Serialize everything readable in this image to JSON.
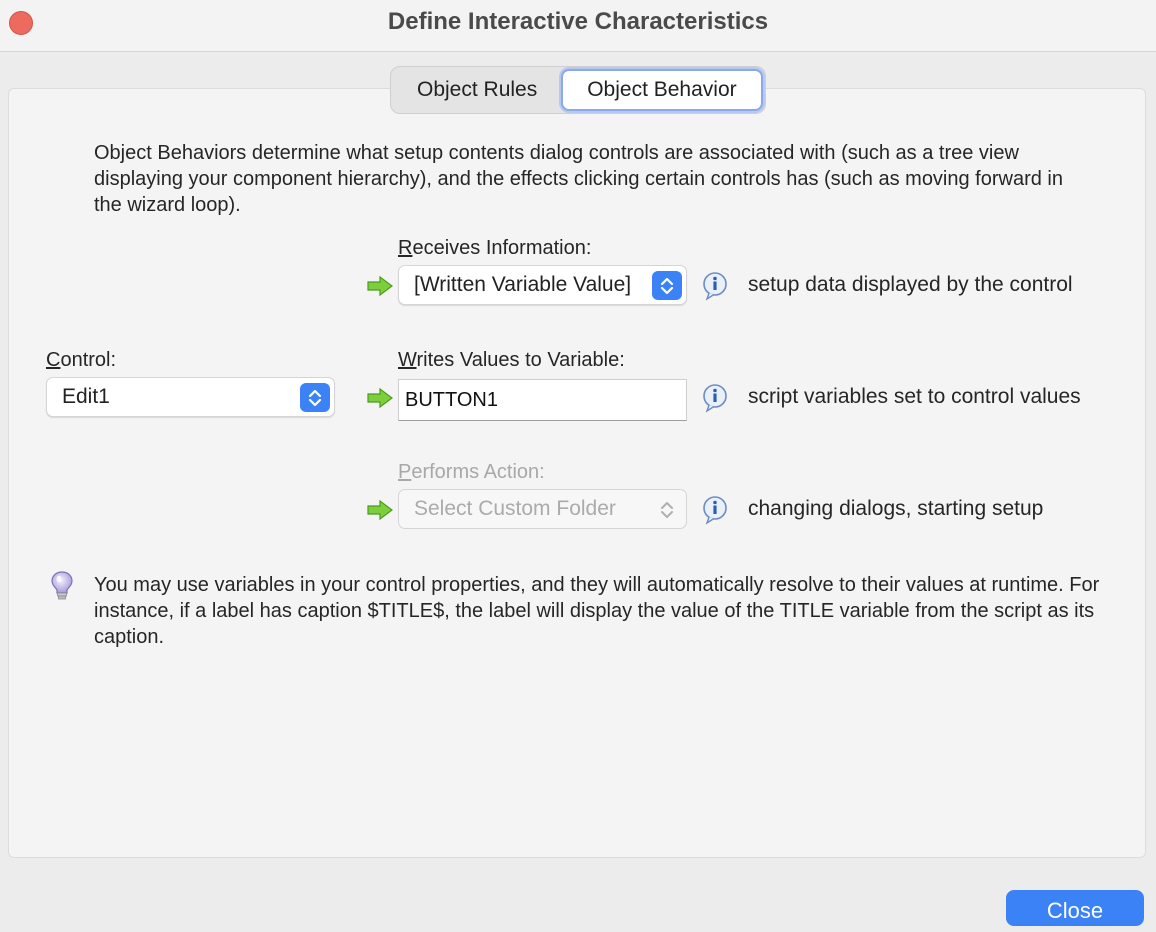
{
  "window": {
    "title": "Define Interactive Characteristics"
  },
  "tabs": [
    {
      "label": "Object Rules",
      "active": false
    },
    {
      "label": "Object Behavior",
      "active": true
    }
  ],
  "description": "Object Behaviors determine what setup contents dialog controls are associated with (such as a tree view displaying your component hierarchy), and the effects clicking certain controls has (such as moving forward in the wizard loop).",
  "control": {
    "label_accel": "C",
    "label_rest": "ontrol:",
    "value": "Edit1"
  },
  "receives": {
    "label_accel": "R",
    "label_rest": "eceives Information:",
    "value": "[Written Variable Value]",
    "hint": "setup data displayed by the control"
  },
  "writes": {
    "label_accel": "W",
    "label_rest": "rites Values to Variable:",
    "value": "BUTTON1",
    "hint": "script variables set to control values"
  },
  "performs": {
    "label_accel": "P",
    "label_rest": "erforms Action:",
    "value": "Select Custom Folder",
    "hint": "changing dialogs, starting setup",
    "disabled": true
  },
  "tip": "You may use variables in your control properties, and they will automatically resolve to their values at runtime. For instance, if a label has caption $TITLE$, the label will display the value of the TITLE variable from the script as its caption.",
  "buttons": {
    "close_label": "Close"
  },
  "colors": {
    "accent": "#3b82f6",
    "arrow_green": "#7ccf3a",
    "close_dot": "#ed6a5e"
  },
  "icons": {
    "arrow": "green-right-arrow-icon",
    "info": "info-icon",
    "tip": "lightbulb-icon",
    "stepper": "chevron-up-down-icon"
  }
}
